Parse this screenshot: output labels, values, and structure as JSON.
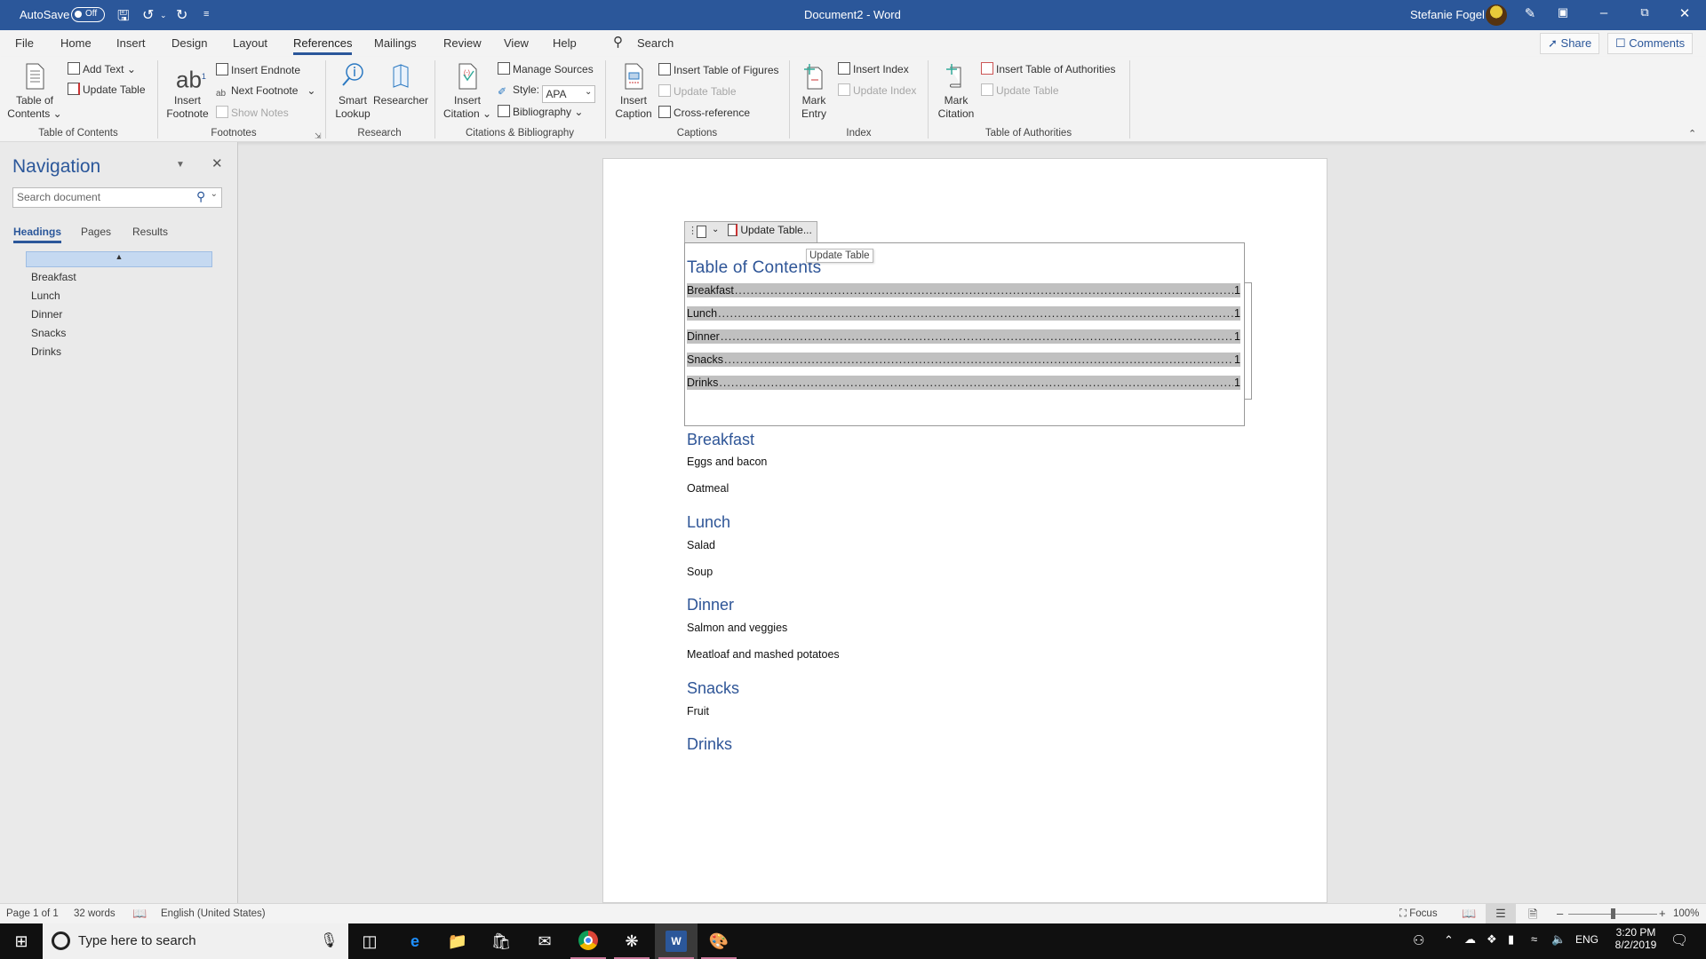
{
  "titlebar": {
    "autosave_label": "AutoSave",
    "autosave_state": "Off",
    "title": "Document2 - Word",
    "user_name": "Stefanie Fogel",
    "icons": [
      "save-icon",
      "undo-icon",
      "redo-icon",
      "customize-quick-access-icon",
      "coauthor-icon",
      "ribbon-display-options-icon",
      "minimize-icon",
      "restore-icon",
      "close-icon"
    ]
  },
  "tabs": {
    "items": [
      "File",
      "Home",
      "Insert",
      "Design",
      "Layout",
      "References",
      "Mailings",
      "Review",
      "View",
      "Help"
    ],
    "active": "References",
    "search_label": "Search",
    "share_label": "Share",
    "comments_label": "Comments"
  },
  "ribbon": {
    "toc": {
      "toc_btn_line1": "Table of",
      "toc_btn_line2": "Contents",
      "add_text": "Add Text",
      "update_table": "Update Table",
      "group": "Table of Contents"
    },
    "footnotes": {
      "insert_footnote_line1": "Insert",
      "insert_footnote_line2": "Footnote",
      "insert_endnote": "Insert Endnote",
      "next_footnote": "Next Footnote",
      "show_notes": "Show Notes",
      "group": "Footnotes"
    },
    "research": {
      "smart_lookup_line1": "Smart",
      "smart_lookup_line2": "Lookup",
      "researcher": "Researcher",
      "group": "Research"
    },
    "citations": {
      "insert_citation_line1": "Insert",
      "insert_citation_line2": "Citation",
      "manage_sources": "Manage Sources",
      "style_label": "Style:",
      "style_value": "APA",
      "bibliography": "Bibliography",
      "group": "Citations & Bibliography"
    },
    "captions": {
      "insert_caption_line1": "Insert",
      "insert_caption_line2": "Caption",
      "insert_table_of_figures": "Insert Table of Figures",
      "update_table": "Update Table",
      "cross_reference": "Cross-reference",
      "group": "Captions"
    },
    "index": {
      "mark_entry_line1": "Mark",
      "mark_entry_line2": "Entry",
      "insert_index": "Insert Index",
      "update_index": "Update Index",
      "group": "Index"
    },
    "authorities": {
      "mark_citation_line1": "Mark",
      "mark_citation_line2": "Citation",
      "insert_toa": "Insert Table of Authorities",
      "update_table": "Update Table",
      "group": "Table of Authorities"
    }
  },
  "navigation": {
    "title": "Navigation",
    "search_placeholder": "Search document",
    "tabs": [
      "Headings",
      "Pages",
      "Results"
    ],
    "active_tab": "Headings",
    "headings": [
      "Breakfast",
      "Lunch",
      "Dinner",
      "Snacks",
      "Drinks"
    ]
  },
  "document": {
    "cc_update_label": "Update Table...",
    "tooltip": "Update Table",
    "toc_title": "Table of Contents",
    "toc_entries": [
      {
        "label": "Breakfast",
        "page": "1"
      },
      {
        "label": "Lunch",
        "page": "1"
      },
      {
        "label": "Dinner",
        "page": "1"
      },
      {
        "label": "Snacks",
        "page": "1"
      },
      {
        "label": "Drinks",
        "page": "1"
      }
    ],
    "sections": [
      {
        "heading": "Breakfast",
        "items": [
          "Eggs and bacon",
          "Oatmeal"
        ]
      },
      {
        "heading": "Lunch",
        "items": [
          "Salad",
          "Soup"
        ]
      },
      {
        "heading": "Dinner",
        "items": [
          "Salmon and veggies",
          "Meatloaf and mashed potatoes"
        ]
      },
      {
        "heading": "Snacks",
        "items": [
          "Fruit"
        ]
      },
      {
        "heading": "Drinks",
        "items": []
      }
    ]
  },
  "status": {
    "page": "Page 1 of 1",
    "words": "32 words",
    "language": "English (United States)",
    "focus": "Focus",
    "zoom": "100%",
    "zoom_percent": 100
  },
  "taskbar": {
    "search_placeholder": "Type here to search",
    "language": "ENG",
    "time": "3:20 PM",
    "date": "8/2/2019"
  },
  "colors": {
    "accent": "#2b579a",
    "heading": "#2e5597",
    "toc_highlight": "#c0c0c0"
  }
}
